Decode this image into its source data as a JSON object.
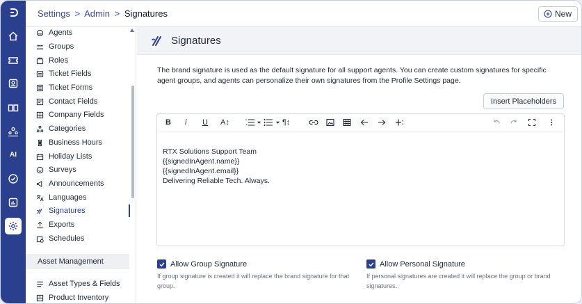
{
  "breadcrumb": {
    "part1": "Settings",
    "sep1": ">",
    "part2": "Admin",
    "sep2": ">",
    "current": "Signatures"
  },
  "top_actions": {
    "new_label": "New"
  },
  "rail": {
    "items": [
      {
        "name": "logo-icon"
      },
      {
        "name": "home-icon"
      },
      {
        "name": "tickets-icon"
      },
      {
        "name": "contacts-icon"
      },
      {
        "name": "knowledge-base-icon"
      },
      {
        "name": "team-icon"
      },
      {
        "name": "ai-icon",
        "text": "AI"
      },
      {
        "name": "tasks-icon"
      },
      {
        "name": "reports-icon"
      },
      {
        "name": "settings-icon"
      }
    ]
  },
  "nav": {
    "items": [
      {
        "label": "Agents",
        "icon": "agent-icon"
      },
      {
        "label": "Groups",
        "icon": "groups-icon"
      },
      {
        "label": "Roles",
        "icon": "roles-icon"
      },
      {
        "label": "Ticket Fields",
        "icon": "ticket-fields-icon"
      },
      {
        "label": "Ticket Forms",
        "icon": "ticket-forms-icon"
      },
      {
        "label": "Contact Fields",
        "icon": "contact-fields-icon"
      },
      {
        "label": "Company Fields",
        "icon": "company-fields-icon"
      },
      {
        "label": "Categories",
        "icon": "categories-icon"
      },
      {
        "label": "Business Hours",
        "icon": "hourglass-icon"
      },
      {
        "label": "Holiday Lists",
        "icon": "calendar-icon"
      },
      {
        "label": "Surveys",
        "icon": "smiley-icon"
      },
      {
        "label": "Announcements",
        "icon": "megaphone-icon"
      },
      {
        "label": "Languages",
        "icon": "translate-icon"
      },
      {
        "label": "Signatures",
        "icon": "signature-icon",
        "active": true
      },
      {
        "label": "Exports",
        "icon": "export-icon"
      },
      {
        "label": "Schedules",
        "icon": "schedule-icon"
      }
    ],
    "section_title": "Asset Management",
    "asset_items": [
      {
        "label": "Asset Types & Fields",
        "icon": "asset-types-icon"
      },
      {
        "label": "Product Inventory",
        "icon": "inventory-icon"
      }
    ]
  },
  "main": {
    "title": "Signatures",
    "description": "The brand signature is used as the default signature for all support agents. You can create custom signatures for specific agent groups, and agents can personalize their own signatures from the Profile Settings page.",
    "insert_placeholders_label": "Insert Placeholders",
    "editor": {
      "toolbar": {
        "bold": "B",
        "italic": "i",
        "underline": "U",
        "font_size": "A↕",
        "paragraph": "¶↕"
      },
      "content_lines": [
        "RTX Solutions Support Team",
        "{{signedInAgent.name}}",
        "{{signedInAgent.email}}",
        "Delivering Reliable Tech. Always."
      ]
    },
    "group_signature": {
      "label": "Allow Group Signature",
      "checked": true,
      "hint": "If group signature is created it will replace the brand signature for that group."
    },
    "personal_signature": {
      "label": "Allow Personal Signature",
      "checked": true,
      "hint": "If personal signatures are created it will replace the group or brand signatures."
    }
  },
  "colors": {
    "brand": "#2b3f8f",
    "link": "#3b4a9c"
  }
}
